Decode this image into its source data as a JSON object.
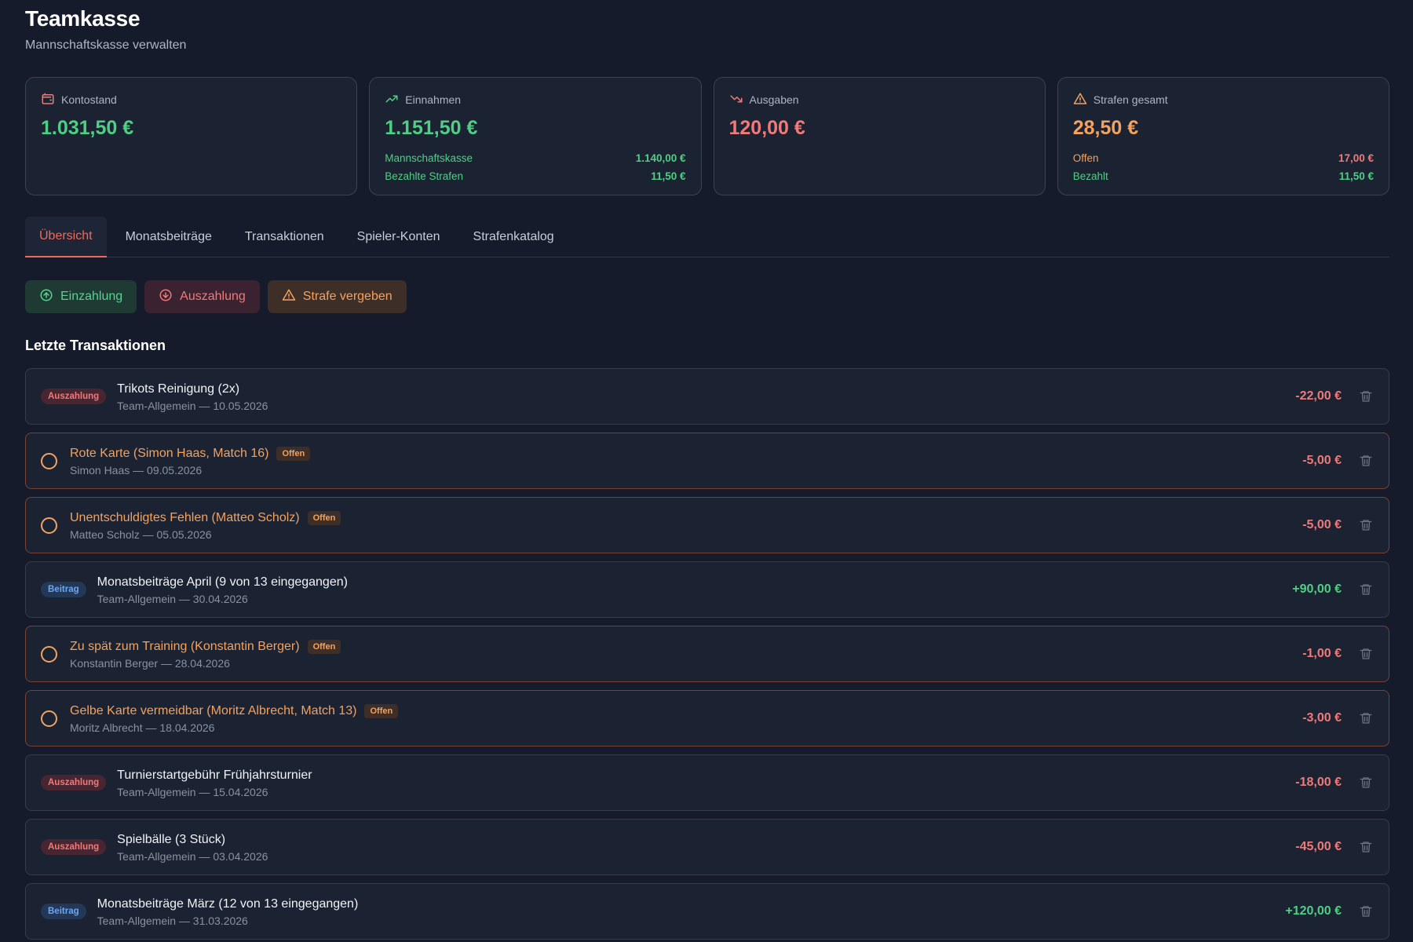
{
  "header": {
    "title": "Teamkasse",
    "subtitle": "Mannschaftskasse verwalten"
  },
  "cards": {
    "balance": {
      "icon": "wallet-icon",
      "label": "Kontostand",
      "value": "1.031,50 €"
    },
    "income": {
      "icon": "trending-up-icon",
      "label": "Einnahmen",
      "value": "1.151,50 €",
      "rows": [
        {
          "label": "Mannschaftskasse",
          "amount": "1.140,00 €"
        },
        {
          "label": "Bezahlte Strafen",
          "amount": "11,50 €"
        }
      ]
    },
    "expenses": {
      "icon": "trending-down-icon",
      "label": "Ausgaben",
      "value": "120,00 €"
    },
    "penalties": {
      "icon": "warning-icon",
      "label": "Strafen gesamt",
      "value": "28,50 €",
      "rows": [
        {
          "label": "Offen",
          "amount": "17,00 €"
        },
        {
          "label": "Bezahlt",
          "amount": "11,50 €"
        }
      ]
    }
  },
  "tabs": [
    {
      "label": "Übersicht",
      "active": true
    },
    {
      "label": "Monatsbeiträge",
      "active": false
    },
    {
      "label": "Transaktionen",
      "active": false
    },
    {
      "label": "Spieler-Konten",
      "active": false
    },
    {
      "label": "Strafenkatalog",
      "active": false
    }
  ],
  "actions": {
    "deposit": "Einzahlung",
    "payout": "Auszahlung",
    "penalty": "Strafe vergeben"
  },
  "section_title": "Letzte Transaktionen",
  "transactions": [
    {
      "type": "payout",
      "badge": "Auszahlung",
      "title": "Trikots Reinigung (2x)",
      "sub": "Team-Allgemein — 10.05.2026",
      "amount": "-22,00 €"
    },
    {
      "type": "penalty",
      "status": "Offen",
      "title": "Rote Karte (Simon Haas, Match 16)",
      "sub": "Simon Haas — 09.05.2026",
      "amount": "-5,00 €"
    },
    {
      "type": "penalty",
      "status": "Offen",
      "title": "Unentschuldigtes Fehlen (Matteo Scholz)",
      "sub": "Matteo Scholz — 05.05.2026",
      "amount": "-5,00 €"
    },
    {
      "type": "fee",
      "badge": "Beitrag",
      "title": "Monatsbeiträge April (9 von 13 eingegangen)",
      "sub": "Team-Allgemein — 30.04.2026",
      "amount": "+90,00 €"
    },
    {
      "type": "penalty",
      "status": "Offen",
      "title": "Zu spät zum Training (Konstantin Berger)",
      "sub": "Konstantin Berger — 28.04.2026",
      "amount": "-1,00 €"
    },
    {
      "type": "penalty",
      "status": "Offen",
      "title": "Gelbe Karte vermeidbar (Moritz Albrecht, Match 13)",
      "sub": "Moritz Albrecht — 18.04.2026",
      "amount": "-3,00 €"
    },
    {
      "type": "payout",
      "badge": "Auszahlung",
      "title": "Turnierstartgebühr Frühjahrsturnier",
      "sub": "Team-Allgemein — 15.04.2026",
      "amount": "-18,00 €"
    },
    {
      "type": "payout",
      "badge": "Auszahlung",
      "title": "Spielbälle (3 Stück)",
      "sub": "Team-Allgemein — 03.04.2026",
      "amount": "-45,00 €"
    },
    {
      "type": "fee",
      "badge": "Beitrag",
      "title": "Monatsbeiträge März (12 von 13 eingegangen)",
      "sub": "Team-Allgemein — 31.03.2026",
      "amount": "+120,00 €"
    }
  ],
  "colors": {
    "background": "#151b2a",
    "positive": "#4fcf84",
    "negative": "#f07a7a",
    "warning": "#f3a25f",
    "active_tab": "#f06a5a",
    "info": "#6ea6f0"
  }
}
